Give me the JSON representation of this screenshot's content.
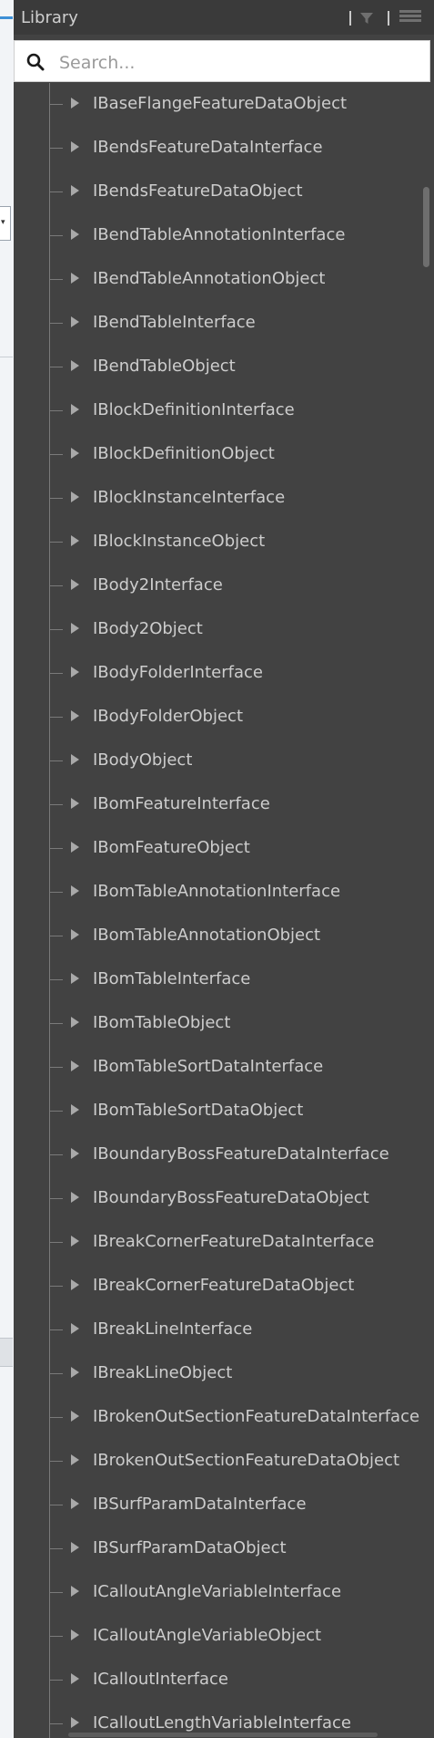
{
  "panel": {
    "title": "Library"
  },
  "search": {
    "placeholder": "Search..."
  },
  "background": {
    "dropdown_glyph": "▾"
  },
  "tree": {
    "items": [
      {
        "label": "IBaseFlangeFeatureDataObject"
      },
      {
        "label": "IBendsFeatureDataInterface"
      },
      {
        "label": "IBendsFeatureDataObject"
      },
      {
        "label": "IBendTableAnnotationInterface"
      },
      {
        "label": "IBendTableAnnotationObject"
      },
      {
        "label": "IBendTableInterface"
      },
      {
        "label": "IBendTableObject"
      },
      {
        "label": "IBlockDefinitionInterface"
      },
      {
        "label": "IBlockDefinitionObject"
      },
      {
        "label": "IBlockInstanceInterface"
      },
      {
        "label": "IBlockInstanceObject"
      },
      {
        "label": "IBody2Interface"
      },
      {
        "label": "IBody2Object"
      },
      {
        "label": "IBodyFolderInterface"
      },
      {
        "label": "IBodyFolderObject"
      },
      {
        "label": "IBodyObject"
      },
      {
        "label": "IBomFeatureInterface"
      },
      {
        "label": "IBomFeatureObject"
      },
      {
        "label": "IBomTableAnnotationInterface"
      },
      {
        "label": "IBomTableAnnotationObject"
      },
      {
        "label": "IBomTableInterface"
      },
      {
        "label": "IBomTableObject"
      },
      {
        "label": "IBomTableSortDataInterface"
      },
      {
        "label": "IBomTableSortDataObject"
      },
      {
        "label": "IBoundaryBossFeatureDataInterface"
      },
      {
        "label": "IBoundaryBossFeatureDataObject"
      },
      {
        "label": "IBreakCornerFeatureDataInterface"
      },
      {
        "label": "IBreakCornerFeatureDataObject"
      },
      {
        "label": "IBreakLineInterface"
      },
      {
        "label": "IBreakLineObject"
      },
      {
        "label": "IBrokenOutSectionFeatureDataInterface"
      },
      {
        "label": "IBrokenOutSectionFeatureDataObject"
      },
      {
        "label": "IBSurfParamDataInterface"
      },
      {
        "label": "IBSurfParamDataObject"
      },
      {
        "label": "ICalloutAngleVariableInterface"
      },
      {
        "label": "ICalloutAngleVariableObject"
      },
      {
        "label": "ICalloutInterface"
      },
      {
        "label": "ICalloutLengthVariableInterface"
      }
    ]
  },
  "colors": {
    "panel_bg": "#424242",
    "header_bg": "#3a3a3a",
    "text": "#cdcdcd",
    "accent": "#3d8fd6"
  },
  "icons": [
    "filter-icon",
    "menu-icon",
    "search-icon",
    "expand-arrow-icon"
  ]
}
